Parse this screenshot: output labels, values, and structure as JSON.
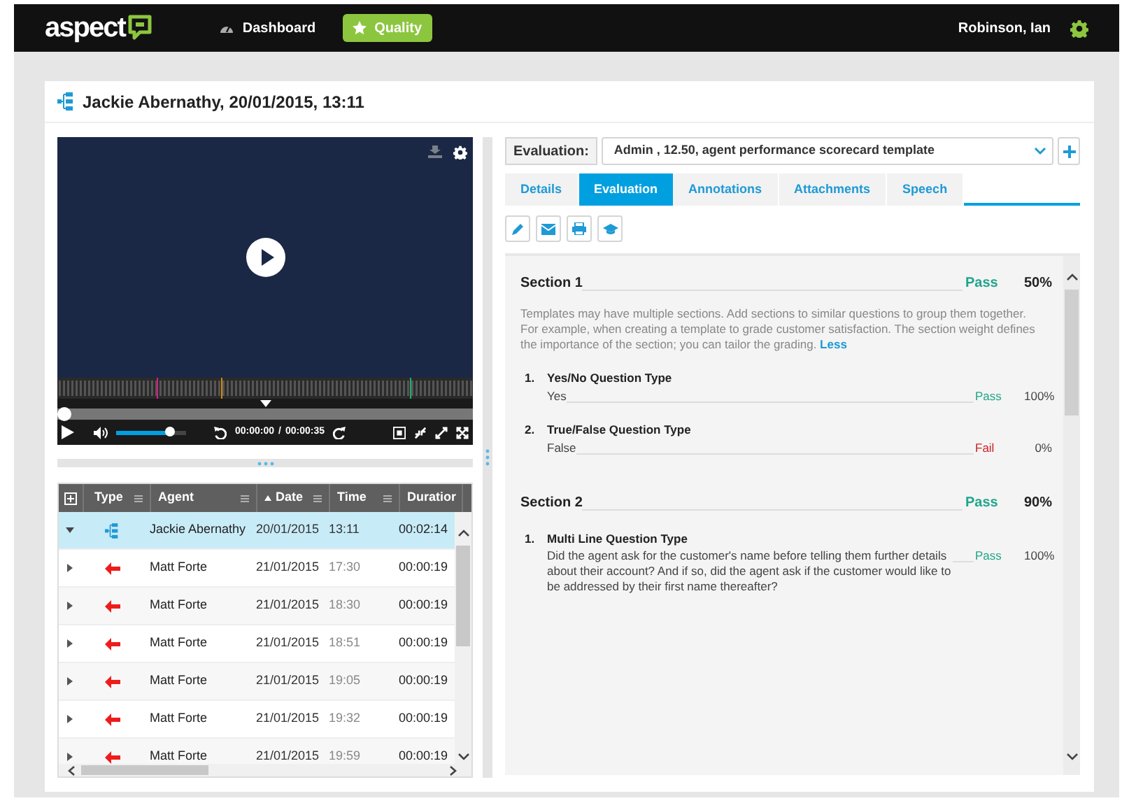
{
  "nav": {
    "logo": "aspect",
    "items": [
      {
        "label": "Dashboard",
        "selected": false
      },
      {
        "label": "Quality",
        "selected": true
      }
    ],
    "user": "Robinson, Ian"
  },
  "record": {
    "title": "Jackie Abernathy, 20/01/2015, 13:11"
  },
  "player": {
    "seek": {
      "level": 0
    },
    "volume": {
      "level": 0.75
    },
    "current_time": "00:00:00",
    "separator": "/",
    "total_time": "00:00:35"
  },
  "table": {
    "columns": [
      {
        "label": "Type",
        "sorted": false
      },
      {
        "label": "Agent",
        "sorted": false
      },
      {
        "label": "Date",
        "sorted": true
      },
      {
        "label": "Time",
        "sorted": false
      },
      {
        "label": "Duratior",
        "sorted": false
      }
    ],
    "rows": [
      {
        "kind": "call",
        "agent": "Jackie Abernathy",
        "date": "20/01/2015",
        "time": "13:11",
        "duration": "00:02:14",
        "selected": true,
        "expanded": true
      },
      {
        "kind": "inbound",
        "agent": "Matt Forte",
        "date": "21/01/2015",
        "time": "17:30",
        "duration": "00:00:19",
        "selected": false,
        "expanded": false
      },
      {
        "kind": "inbound",
        "agent": "Matt Forte",
        "date": "21/01/2015",
        "time": "18:30",
        "duration": "00:00:19",
        "selected": false,
        "expanded": false
      },
      {
        "kind": "inbound",
        "agent": "Matt Forte",
        "date": "21/01/2015",
        "time": "18:51",
        "duration": "00:00:19",
        "selected": false,
        "expanded": false
      },
      {
        "kind": "inbound",
        "agent": "Matt Forte",
        "date": "21/01/2015",
        "time": "19:05",
        "duration": "00:00:19",
        "selected": false,
        "expanded": false
      },
      {
        "kind": "inbound",
        "agent": "Matt Forte",
        "date": "21/01/2015",
        "time": "19:32",
        "duration": "00:00:19",
        "selected": false,
        "expanded": false
      },
      {
        "kind": "inbound",
        "agent": "Matt Forte",
        "date": "21/01/2015",
        "time": "19:59",
        "duration": "00:00:19",
        "selected": false,
        "expanded": false
      }
    ]
  },
  "evaluation": {
    "label": "Evaluation:",
    "value": "Admin , 12.50, agent performance scorecard template"
  },
  "tabs": [
    {
      "label": "Details",
      "selected": false
    },
    {
      "label": "Evaluation",
      "selected": true
    },
    {
      "label": "Annotations",
      "selected": false
    },
    {
      "label": "Attachments",
      "selected": false
    },
    {
      "label": "Speech",
      "selected": false
    }
  ],
  "sections": [
    {
      "title": "Section 1",
      "result": "Pass",
      "passed": true,
      "score": "50%",
      "description": "Templates may have multiple sections. Add sections to similar questions to group them together. For example, when creating a template to grade customer satisfaction. The section weight defines the importance of the section; you can tailor the grading.",
      "toggle": "Less",
      "questions": [
        {
          "number": "1.",
          "title": "Yes/No Question Type",
          "answer": "Yes",
          "result": "Pass",
          "passed": true,
          "score": "100%"
        },
        {
          "number": "2.",
          "title": "True/False Question Type",
          "answer": "False",
          "result": "Fail",
          "passed": false,
          "score": "0%"
        }
      ]
    },
    {
      "title": "Section 2",
      "result": "Pass",
      "passed": true,
      "score": "90%",
      "questions": [
        {
          "number": "1.",
          "title": "Multi Line Question Type",
          "answer": "Did the agent ask for the customer's name before telling them further details about their account? And if so, did the agent ask if the customer would like to be addressed by their first name thereafter?",
          "result": "Pass",
          "passed": true,
          "score": "100%"
        }
      ]
    }
  ]
}
